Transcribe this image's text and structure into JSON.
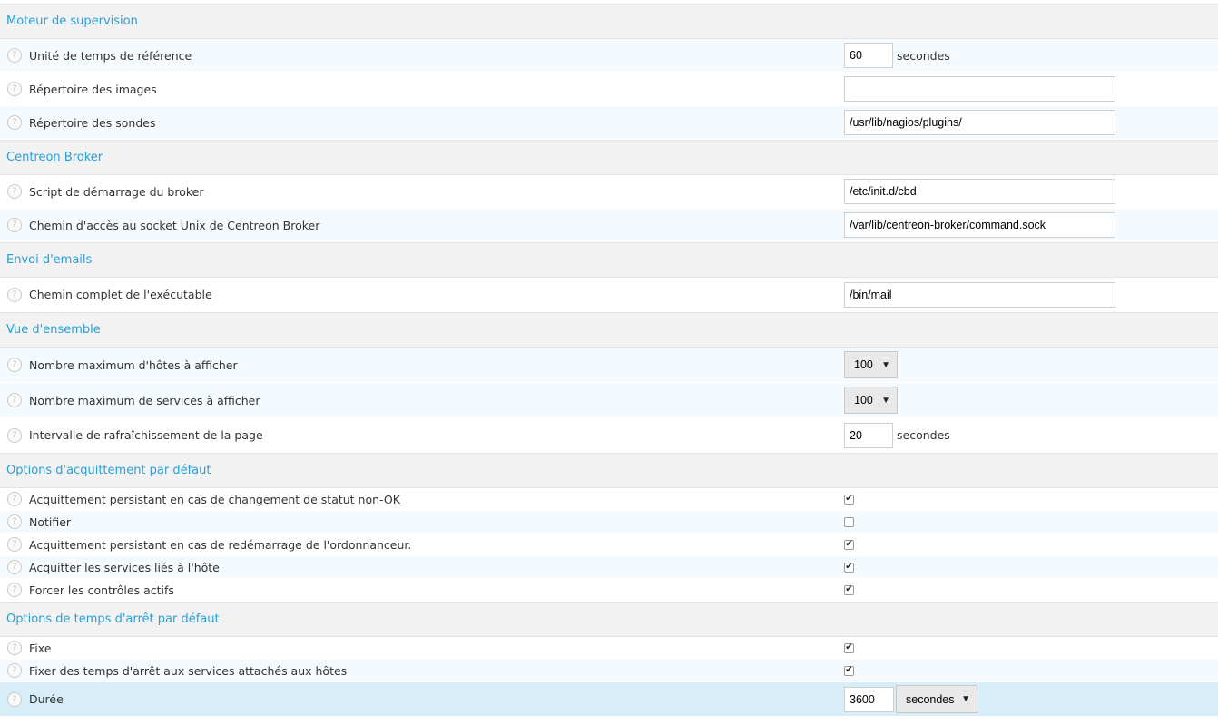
{
  "sections": {
    "engine": {
      "title": "Moteur de supervision",
      "interval_length": {
        "label": "Unité de temps de référence",
        "value": "60",
        "unit": "secondes"
      },
      "images_dir": {
        "label": "Répertoire des images",
        "value": ""
      },
      "plugins_dir": {
        "label": "Répertoire des sondes",
        "value": "/usr/lib/nagios/plugins/"
      }
    },
    "broker": {
      "title": "Centreon Broker",
      "init_script": {
        "label": "Script de démarrage du broker",
        "value": "/etc/init.d/cbd"
      },
      "socket_path": {
        "label": "Chemin d'accès au socket Unix de Centreon Broker",
        "value": "/var/lib/centreon-broker/command.sock"
      }
    },
    "mail": {
      "title": "Envoi d'emails",
      "mailer_path": {
        "label": "Chemin complet de l'exécutable",
        "value": "/bin/mail"
      }
    },
    "overview": {
      "title": "Vue d'ensemble",
      "max_hosts": {
        "label": "Nombre maximum d'hôtes à afficher",
        "value": "100"
      },
      "max_services": {
        "label": "Nombre maximum de services à afficher",
        "value": "100"
      },
      "refresh": {
        "label": "Intervalle de rafraîchissement de la page",
        "value": "20",
        "unit": "secondes"
      }
    },
    "ack": {
      "title": "Options d'acquittement par défaut",
      "sticky": {
        "label": "Acquittement persistant en cas de changement de statut non-OK",
        "checked": true
      },
      "notify": {
        "label": "Notifier",
        "checked": false
      },
      "persistent": {
        "label": "Acquittement persistant en cas de redémarrage de l'ordonnanceur.",
        "checked": true
      },
      "ack_services": {
        "label": "Acquitter les services liés à l'hôte",
        "checked": true
      },
      "force_active": {
        "label": "Forcer les contrôles actifs",
        "checked": true
      }
    },
    "downtime": {
      "title": "Options de temps d'arrêt par défaut",
      "fixed": {
        "label": "Fixe",
        "checked": true
      },
      "with_services": {
        "label": "Fixer des temps d'arrêt aux services attachés aux hôtes",
        "checked": true
      },
      "duration": {
        "label": "Durée",
        "value": "3600",
        "unit": "secondes"
      }
    }
  },
  "help_glyph": "?",
  "check_glyph": "✔",
  "select_arrow": "▼",
  "icons": {
    "help": "question-circle-icon",
    "dropdown": "chevron-down-icon"
  }
}
